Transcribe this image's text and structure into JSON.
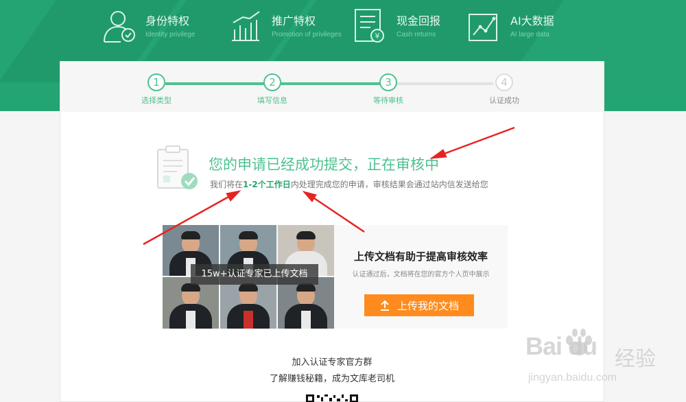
{
  "features": [
    {
      "title": "身份特权",
      "subtitle": "Identity privilege",
      "icon": "identity-user-icon"
    },
    {
      "title": "推广特权",
      "subtitle": "Promotion of privileges",
      "icon": "bar-chart-icon"
    },
    {
      "title": "现金回报",
      "subtitle": "Cash returns",
      "icon": "cash-document-icon"
    },
    {
      "title": "AI大数据",
      "subtitle": "AI large data",
      "icon": "line-chart-icon"
    }
  ],
  "steps": [
    {
      "number": "1",
      "label": "选择类型",
      "state": "done"
    },
    {
      "number": "2",
      "label": "填写信息",
      "state": "done"
    },
    {
      "number": "3",
      "label": "等待审核",
      "state": "current"
    },
    {
      "number": "4",
      "label": "认证成功",
      "state": "pending"
    }
  ],
  "status": {
    "headline": "您的申请已经成功提交，正在审核中",
    "sub_prefix": "我们将在",
    "sub_highlight": "1-2个工作日",
    "sub_suffix": "内处理完成您的申请，审核结果会通过站内信发送给您"
  },
  "promo": {
    "caption": "15w+认证专家已上传文档",
    "title": "上传文档有助于提高审核效率",
    "desc": "认证通过后，文档将在您的官方个人页中展示",
    "button": "上传我的文档"
  },
  "join": {
    "line1": "加入认证专家官方群",
    "line2": "了解赚钱秘籍，成为文库老司机"
  },
  "watermark": {
    "logo": "Bai du",
    "cn": "经验",
    "url": "jingyan.baidu.com"
  },
  "colors": {
    "brand_green": "#23a472",
    "step_green": "#4dc28f",
    "accent_orange": "#ff8b1e",
    "annotation_red": "#e52421"
  }
}
